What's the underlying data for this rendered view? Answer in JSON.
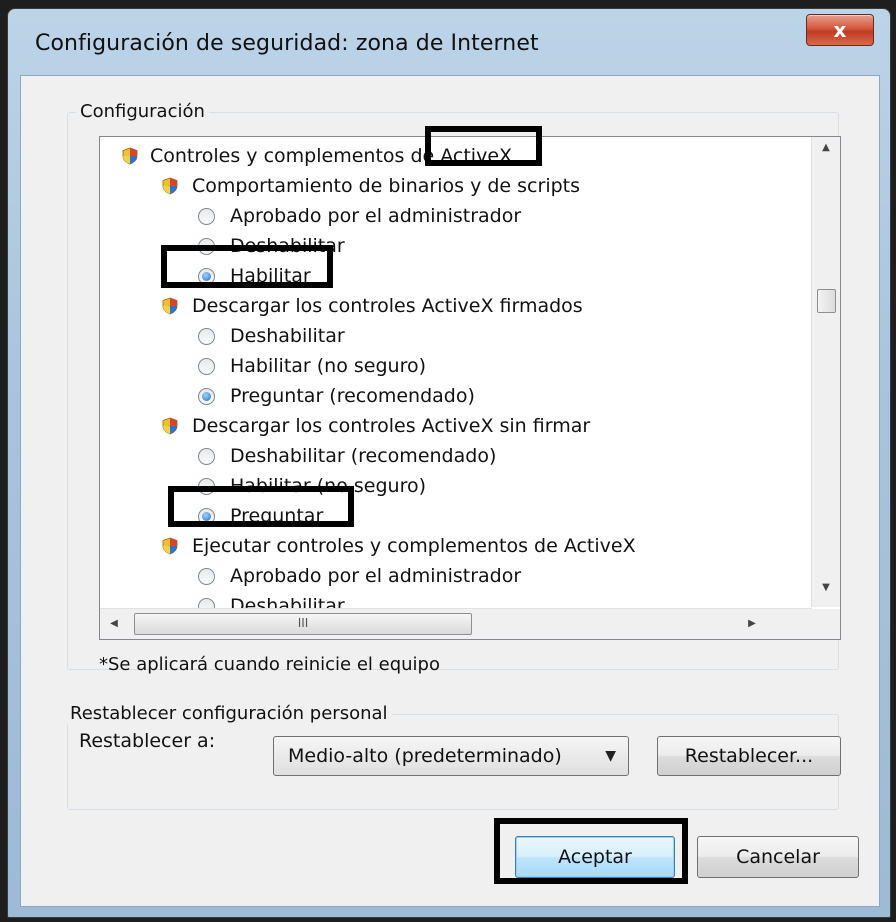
{
  "window": {
    "title": "Configuración de seguridad: zona de Internet",
    "close_label": "x"
  },
  "settings": {
    "group_label": "Configuración",
    "tree": [
      {
        "kind": "category",
        "level": 0,
        "label": "Controles y complementos de ActiveX"
      },
      {
        "kind": "setting",
        "level": 1,
        "label": "Comportamiento de binarios y de scripts"
      },
      {
        "kind": "option",
        "level": 2,
        "label": "Aprobado por el administrador",
        "checked": false
      },
      {
        "kind": "option",
        "level": 2,
        "label": "Deshabilitar",
        "checked": false
      },
      {
        "kind": "option",
        "level": 2,
        "label": "Habilitar",
        "checked": true
      },
      {
        "kind": "setting",
        "level": 1,
        "label": "Descargar los controles ActiveX firmados"
      },
      {
        "kind": "option",
        "level": 2,
        "label": "Deshabilitar",
        "checked": false
      },
      {
        "kind": "option",
        "level": 2,
        "label": "Habilitar (no seguro)",
        "checked": false
      },
      {
        "kind": "option",
        "level": 2,
        "label": "Preguntar (recomendado)",
        "checked": true
      },
      {
        "kind": "setting",
        "level": 1,
        "label": "Descargar los controles ActiveX sin firmar"
      },
      {
        "kind": "option",
        "level": 2,
        "label": "Deshabilitar (recomendado)",
        "checked": false
      },
      {
        "kind": "option",
        "level": 2,
        "label": "Habilitar (no seguro)",
        "checked": false
      },
      {
        "kind": "option",
        "level": 2,
        "label": "Preguntar",
        "checked": true
      },
      {
        "kind": "setting",
        "level": 1,
        "label": "Ejecutar controles y complementos de ActiveX"
      },
      {
        "kind": "option",
        "level": 2,
        "label": "Aprobado por el administrador",
        "checked": false
      },
      {
        "kind": "option",
        "level": 2,
        "label": "Deshabilitar",
        "checked": false
      }
    ],
    "hscroll_thumb_glyph": "III",
    "restart_note": "*Se aplicará cuando reinicie el equipo"
  },
  "reset": {
    "group_label": "Restablecer configuración personal",
    "reset_to_label": "Restablecer a:",
    "level_value": "Medio-alto (predeterminado)",
    "reset_button": "Restablecer..."
  },
  "footer": {
    "ok_button": "Aceptar",
    "cancel_button": "Cancelar"
  },
  "colors": {
    "highlight_box": "#000000",
    "title_bar": "#a9c4dd",
    "close_button": "#c03b22"
  }
}
